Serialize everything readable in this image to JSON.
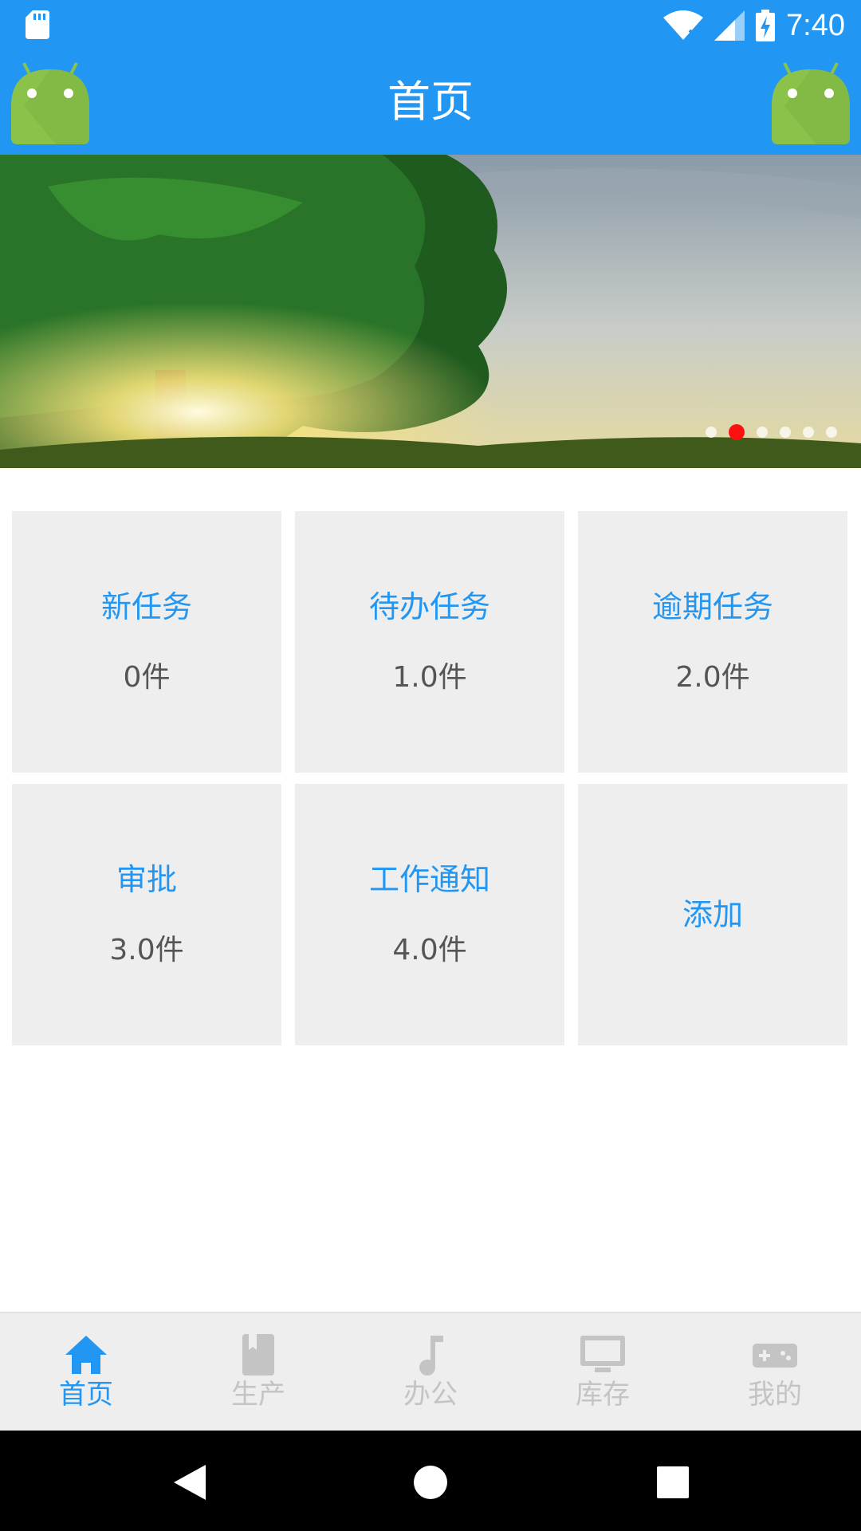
{
  "status_bar": {
    "time": "7:40",
    "icons": [
      "sd-card-icon",
      "wifi-icon",
      "signal-icon",
      "battery-charging-icon"
    ]
  },
  "app_bar": {
    "title": "首页",
    "left_icon": "android-icon",
    "right_icon": "android-icon"
  },
  "banner": {
    "dot_count": 6,
    "active_dot": 2
  },
  "tiles": [
    {
      "title": "新任务",
      "count": "0件"
    },
    {
      "title": "待办任务",
      "count": "1.0件"
    },
    {
      "title": "逾期任务",
      "count": "2.0件"
    },
    {
      "title": "审批",
      "count": "3.0件"
    },
    {
      "title": "工作通知",
      "count": "4.0件"
    },
    {
      "title": "添加",
      "count": ""
    }
  ],
  "bottom_nav": {
    "items": [
      {
        "label": "首页",
        "icon": "home-icon",
        "active": true
      },
      {
        "label": "生产",
        "icon": "book-icon",
        "active": false
      },
      {
        "label": "办公",
        "icon": "music-note-icon",
        "active": false
      },
      {
        "label": "库存",
        "icon": "monitor-icon",
        "active": false
      },
      {
        "label": "我的",
        "icon": "gamepad-icon",
        "active": false
      }
    ]
  },
  "system_nav": {
    "buttons": [
      "back-icon",
      "home-circle-icon",
      "recents-icon"
    ]
  },
  "colors": {
    "primary": "#2196f3",
    "tile_bg": "#eeeeee",
    "inactive_nav": "#c4c4c4",
    "active_dot": "#ff1010"
  }
}
